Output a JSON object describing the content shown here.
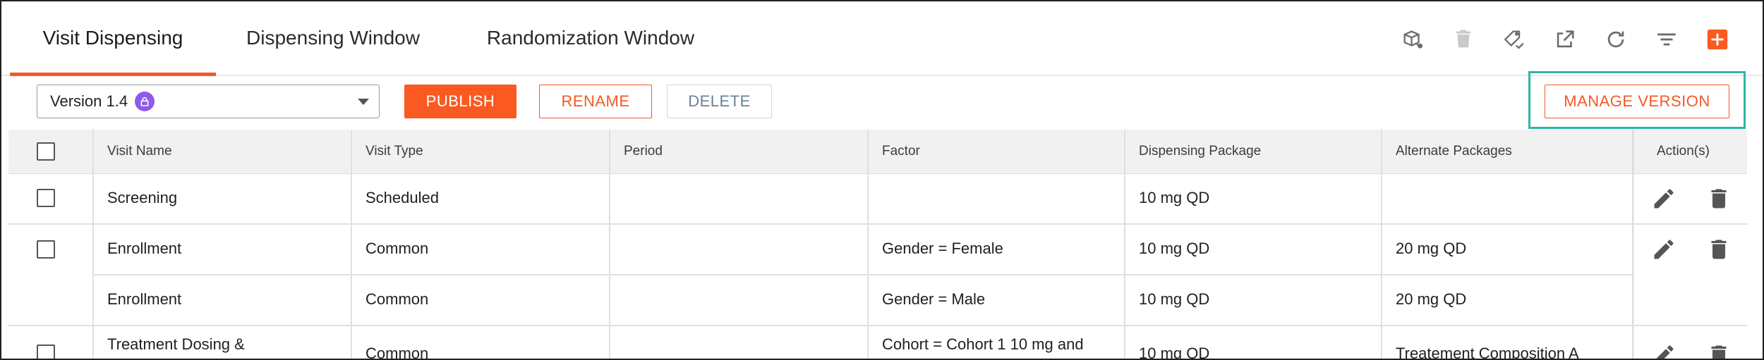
{
  "tabs": [
    {
      "label": "Visit Dispensing",
      "active": true
    },
    {
      "label": "Dispensing Window",
      "active": false
    },
    {
      "label": "Randomization Window",
      "active": false
    }
  ],
  "toolbar_icons": [
    "box-share-icon",
    "trash-icon",
    "tag-check-icon",
    "open-external-icon",
    "refresh-icon",
    "filter-icon",
    "add-icon"
  ],
  "version_select": {
    "value": "Version 1.4",
    "locked_icon": "lock-icon"
  },
  "buttons": {
    "publish": "PUBLISH",
    "rename": "RENAME",
    "delete": "DELETE",
    "manage_version": "MANAGE VERSION"
  },
  "table": {
    "columns": [
      "Visit Name",
      "Visit Type",
      "Period",
      "Factor",
      "Dispensing Package",
      "Alternate Packages",
      "Action(s)"
    ],
    "rows": [
      {
        "visit_name": "Screening",
        "visit_type": "Scheduled",
        "period": "",
        "factor": "",
        "dispensing_package": "10 mg QD",
        "alternate_packages": ""
      },
      {
        "visit_name": "Enrollment",
        "visit_type": "Common",
        "period": "",
        "factor": "Gender = Female",
        "dispensing_package": "10 mg QD",
        "alternate_packages": "20 mg QD"
      },
      {
        "visit_name": "Enrollment",
        "visit_type": "Common",
        "period": "",
        "factor": "Gender = Male",
        "dispensing_package": "10 mg QD",
        "alternate_packages": "20 mg QD"
      },
      {
        "visit_name": "Treatment Dosing &",
        "visit_type": "Common",
        "period": "",
        "factor": "Cohort = Cohort 1 10 mg and",
        "dispensing_package": "10 mg QD",
        "alternate_packages": "Treatement Composition A"
      }
    ]
  },
  "colors": {
    "accent": "#fa5a22",
    "highlight": "#2fb5a6",
    "lock_badge": "#8e5ae8"
  }
}
